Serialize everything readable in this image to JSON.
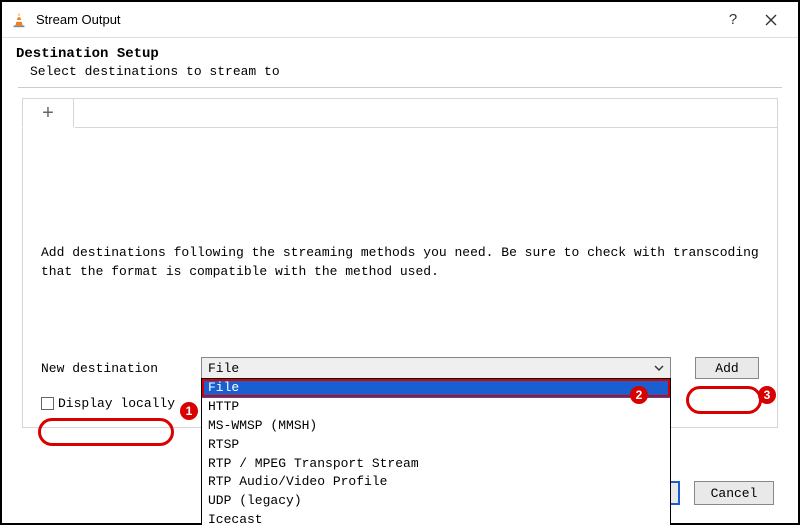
{
  "window": {
    "title": "Stream Output"
  },
  "header": {
    "title": "Destination Setup",
    "subtitle": "Select destinations to stream to"
  },
  "body": {
    "description": "Add destinations following the streaming methods you need. Be sure to check with transcoding that the format is compatible with the method used.",
    "new_destination_label": "New destination",
    "display_locally_label": "Display locally",
    "add_label": "Add",
    "select": {
      "selected": "File",
      "options": [
        "File",
        "HTTP",
        "MS-WMSP (MMSH)",
        "RTSP",
        "RTP / MPEG Transport Stream",
        "RTP Audio/Video Profile",
        "UDP (legacy)",
        "Icecast"
      ]
    }
  },
  "footer": {
    "cancel": "Cancel"
  },
  "annotations": {
    "a1": "1",
    "a2": "2",
    "a3": "3"
  }
}
